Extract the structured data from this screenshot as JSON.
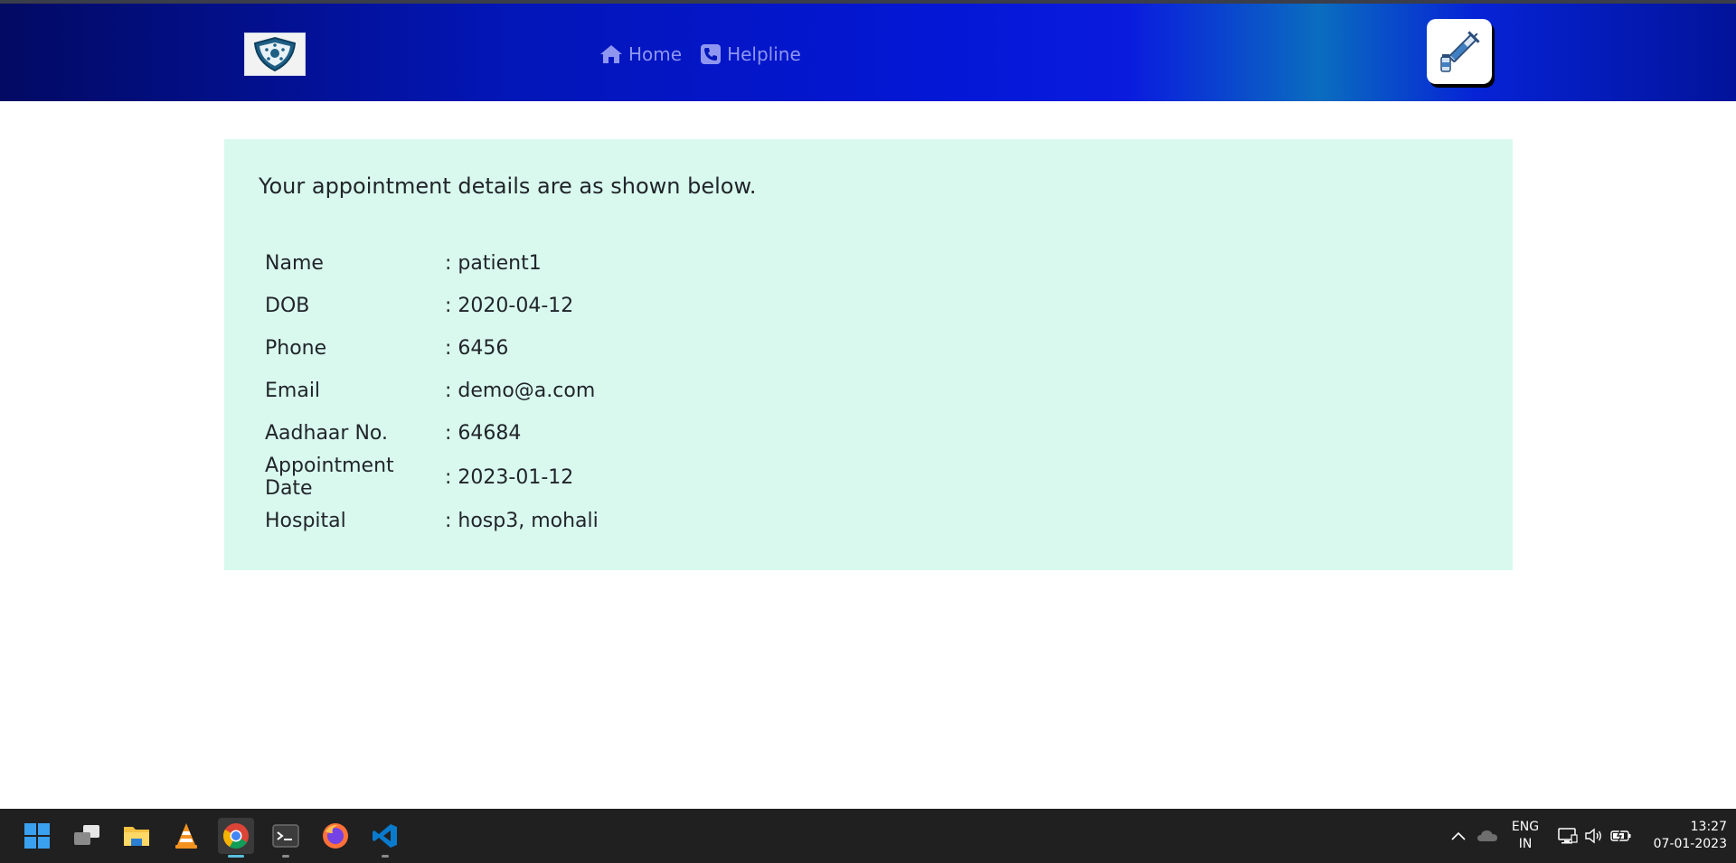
{
  "nav": {
    "links": [
      {
        "label": "Home",
        "icon": "home-icon"
      },
      {
        "label": "Helpline",
        "icon": "phone-icon"
      }
    ]
  },
  "appointment": {
    "heading": "Your appointment details are as shown below.",
    "rows": [
      {
        "label": "Name",
        "value": ": patient1"
      },
      {
        "label": "DOB",
        "value": ": 2020-04-12"
      },
      {
        "label": "Phone",
        "value": ": 6456"
      },
      {
        "label": "Email",
        "value": ": demo@a.com"
      },
      {
        "label": "Aadhaar No.",
        "value": ": 64684"
      },
      {
        "label": "Appointment Date",
        "value": ": 2023-01-12"
      },
      {
        "label": "Hospital",
        "value": ": hosp3, mohali"
      }
    ]
  },
  "taskbar": {
    "apps": [
      "start-icon",
      "task-view-icon",
      "file-explorer-icon",
      "vlc-icon",
      "chrome-icon",
      "terminal-icon",
      "firefox-icon",
      "vscode-icon"
    ],
    "tray": {
      "lang_line1": "ENG",
      "lang_line2": "IN",
      "time": "13:27",
      "date": "07-01-2023"
    }
  },
  "colors": {
    "panel_bg": "#d9f9ef",
    "nav_link": "#8f96f0",
    "navbar_dark": "#020a63",
    "navbar_bright": "#0417d6",
    "taskbar": "#202020"
  }
}
